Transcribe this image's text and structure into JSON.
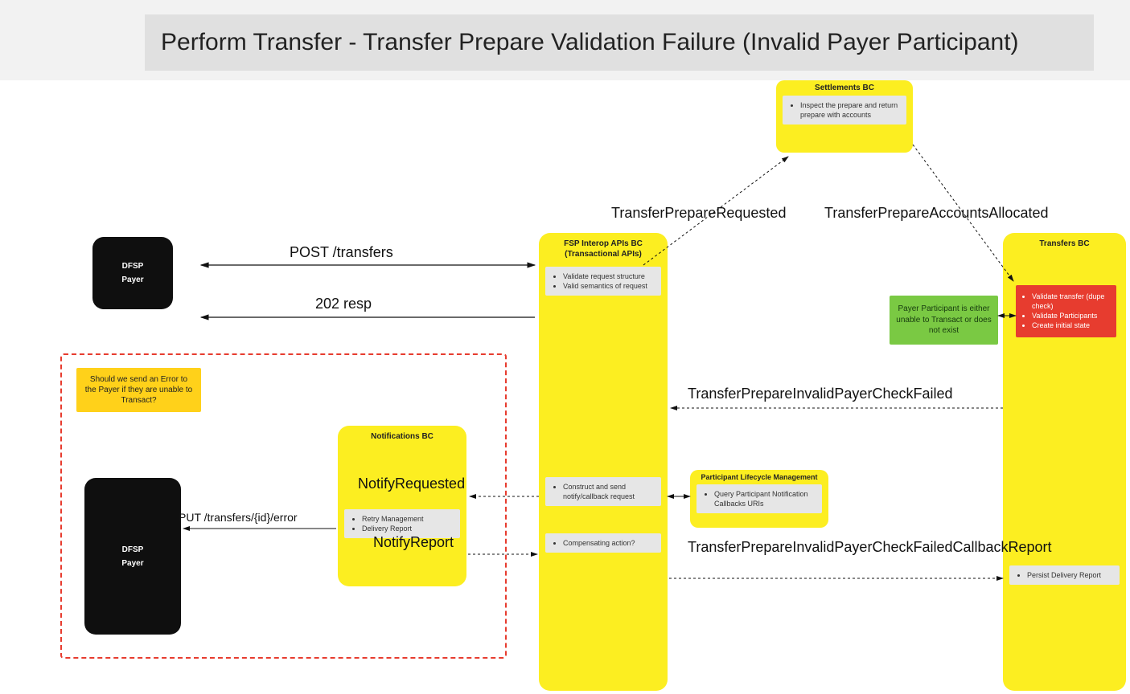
{
  "title": "Perform Transfer - Transfer Prepare Validation Failure (Invalid Payer Participant)",
  "dfsp1": {
    "line1": "DFSP",
    "line2": "Payer"
  },
  "dfsp2": {
    "line1": "DFSP",
    "line2": "Payer"
  },
  "fsp": {
    "header": "FSP Interop APIs BC",
    "sub": "(Transactional APIs)",
    "card1": [
      "Validate request structure",
      "Valid semantics of request"
    ],
    "card2": [
      "Construct and send notify/callback request"
    ],
    "card3": [
      "Compensating action?"
    ]
  },
  "transfers": {
    "header": "Transfers BC",
    "red": [
      "Validate transfer (dupe check)",
      "Validate Participants",
      "Create initial state"
    ],
    "card1": [
      "Persist Delivery Report"
    ]
  },
  "settlements": {
    "header": "Settlements BC",
    "card1": [
      "Inspect the prepare and return prepare with accounts"
    ]
  },
  "notifications": {
    "header": "Notifications BC",
    "card1": [
      "Retry Management",
      "Delivery Report"
    ]
  },
  "plm": {
    "header": "Participant Lifecycle Management",
    "card1": [
      "Query Participant Notification Callbacks URIs"
    ]
  },
  "note": "Should we send an Error to the Payer if they are unable to Transact?",
  "green": "Payer Participant is either unable to Transact or does not exist",
  "labels": {
    "post": "POST /transfers",
    "resp": "202 resp",
    "put": "PUT /transfers/{id}/error",
    "notifyReq": "NotifyRequested",
    "notifyRep": "NotifyReport",
    "tprReq": "TransferPrepareRequested",
    "tprAlloc": "TransferPrepareAccountsAllocated",
    "tprFail": "TransferPrepareInvalidPayerCheckFailed",
    "tprCb": "TransferPrepareInvalidPayerCheckFailedCallbackReport"
  }
}
